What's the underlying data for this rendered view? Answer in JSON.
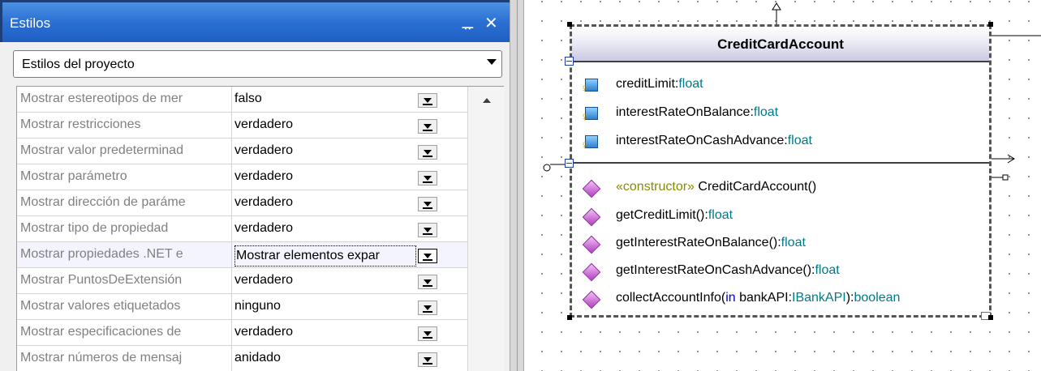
{
  "panel": {
    "title": "Estilos",
    "pin_glyph": "ᅲ",
    "close_glyph": "✕",
    "style_scope": "Estilos del proyecto"
  },
  "properties": [
    {
      "name": "Mostrar estereotipos de mer",
      "value": "falso"
    },
    {
      "name": "Mostrar restricciones",
      "value": "verdadero"
    },
    {
      "name": "Mostrar valor predeterminad",
      "value": "verdadero"
    },
    {
      "name": "Mostrar parámetro",
      "value": "verdadero"
    },
    {
      "name": "Mostrar dirección de paráme",
      "value": "verdadero"
    },
    {
      "name": "Mostrar tipo de propiedad",
      "value": "verdadero"
    },
    {
      "name": "Mostrar propiedades .NET e",
      "value": "Mostrar elementos expar"
    },
    {
      "name": "Mostrar PuntosDeExtensión",
      "value": "verdadero"
    },
    {
      "name": "Mostrar valores etiquetados",
      "value": "ninguno"
    },
    {
      "name": "Mostrar especificaciones de",
      "value": "verdadero"
    },
    {
      "name": "Mostrar números de mensaj",
      "value": "anidado"
    }
  ],
  "selected_property_index": 6,
  "diagram": {
    "class_name": "CreditCardAccount",
    "attributes": [
      {
        "name": "creditLimit",
        "type": "float"
      },
      {
        "name": "interestRateOnBalance",
        "type": "float"
      },
      {
        "name": "interestRateOnCashAdvance",
        "type": "float"
      }
    ],
    "operations": {
      "constructor_stereotype": "«constructor»",
      "constructor_name": "CreditCardAccount()",
      "op1_name": "getCreditLimit()",
      "op1_type": "float",
      "op2_name": "getInterestRateOnBalance()",
      "op2_type": "float",
      "op3_name": "getInterestRateOnCashAdvance()",
      "op3_type": "float",
      "op4_name": "collectAccountInfo(",
      "op4_dir": "in",
      "op4_param": " bankAPI:",
      "op4_ptype": "IBankAPI",
      "op4_close": "):",
      "op4_type": "boolean"
    },
    "colors": {
      "type_text": "#007a8a",
      "stereotype_text": "#8a8a00",
      "keyword_text": "#0000c0",
      "operation_icon": "#c060d0",
      "attribute_icon": "#2e7fcf"
    }
  }
}
